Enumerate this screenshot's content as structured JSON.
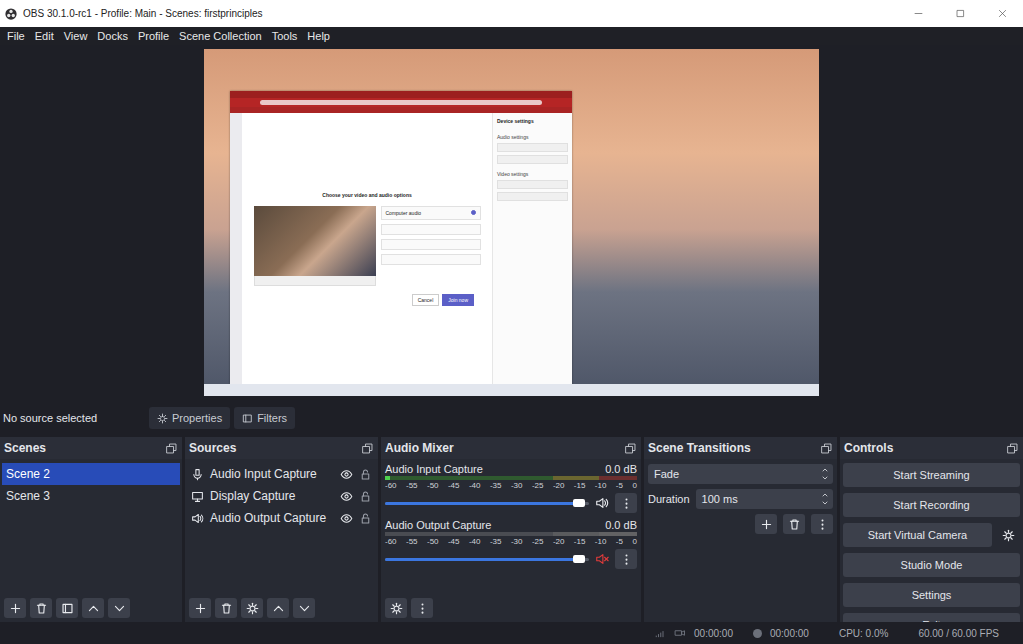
{
  "window": {
    "title": "OBS 30.1.0-rc1 - Profile: Main - Scenes: firstprinciples"
  },
  "menu": [
    "File",
    "Edit",
    "View",
    "Docks",
    "Profile",
    "Scene Collection",
    "Tools",
    "Help"
  ],
  "preview": {
    "inner_window": {
      "heading": "Choose your video and audio options",
      "panel_title": "Device settings",
      "sections": [
        "Audio settings",
        "Video settings"
      ],
      "option": {
        "label": "Computer audio",
        "selected": true
      },
      "buttons": [
        "Cancel",
        "Join now"
      ]
    }
  },
  "source_bar": {
    "label": "No source selected",
    "buttons": [
      "Properties",
      "Filters"
    ]
  },
  "scenes": {
    "title": "Scenes",
    "items": [
      {
        "label": "Scene 2",
        "selected": true
      },
      {
        "label": "Scene 3",
        "selected": false
      }
    ]
  },
  "sources": {
    "title": "Sources",
    "items": [
      {
        "label": "Audio Input Capture",
        "kind": "mic",
        "visible": true,
        "locked": false
      },
      {
        "label": "Display Capture",
        "kind": "display",
        "visible": true,
        "locked": false
      },
      {
        "label": "Audio Output Capture",
        "kind": "speaker",
        "visible": true,
        "locked": false
      }
    ]
  },
  "audio_mixer": {
    "title": "Audio Mixer",
    "scale": [
      "-60",
      "-55",
      "-50",
      "-45",
      "-40",
      "-35",
      "-30",
      "-25",
      "-20",
      "-15",
      "-10",
      "-5",
      "0"
    ],
    "channels": [
      {
        "name": "Audio Input Capture",
        "reading": "0.0 dB",
        "level": 0.98,
        "meter": 0.02,
        "muted": false
      },
      {
        "name": "Audio Output Capture",
        "reading": "0.0 dB",
        "level": 0.98,
        "meter": 0,
        "muted": true
      }
    ]
  },
  "scene_transitions": {
    "title": "Scene Transitions",
    "transition": "Fade",
    "duration_label": "Duration",
    "duration": "100 ms"
  },
  "controls": {
    "title": "Controls",
    "buttons": [
      "Start Streaming",
      "Start Recording",
      "Start Virtual Camera",
      "Studio Mode",
      "Settings",
      "Exit"
    ]
  },
  "status_bar": {
    "stream_time": "00:00:00",
    "record_time": "00:00:00",
    "cpu": "CPU: 0.0%",
    "fps": "60.00 / 60.00 FPS"
  }
}
